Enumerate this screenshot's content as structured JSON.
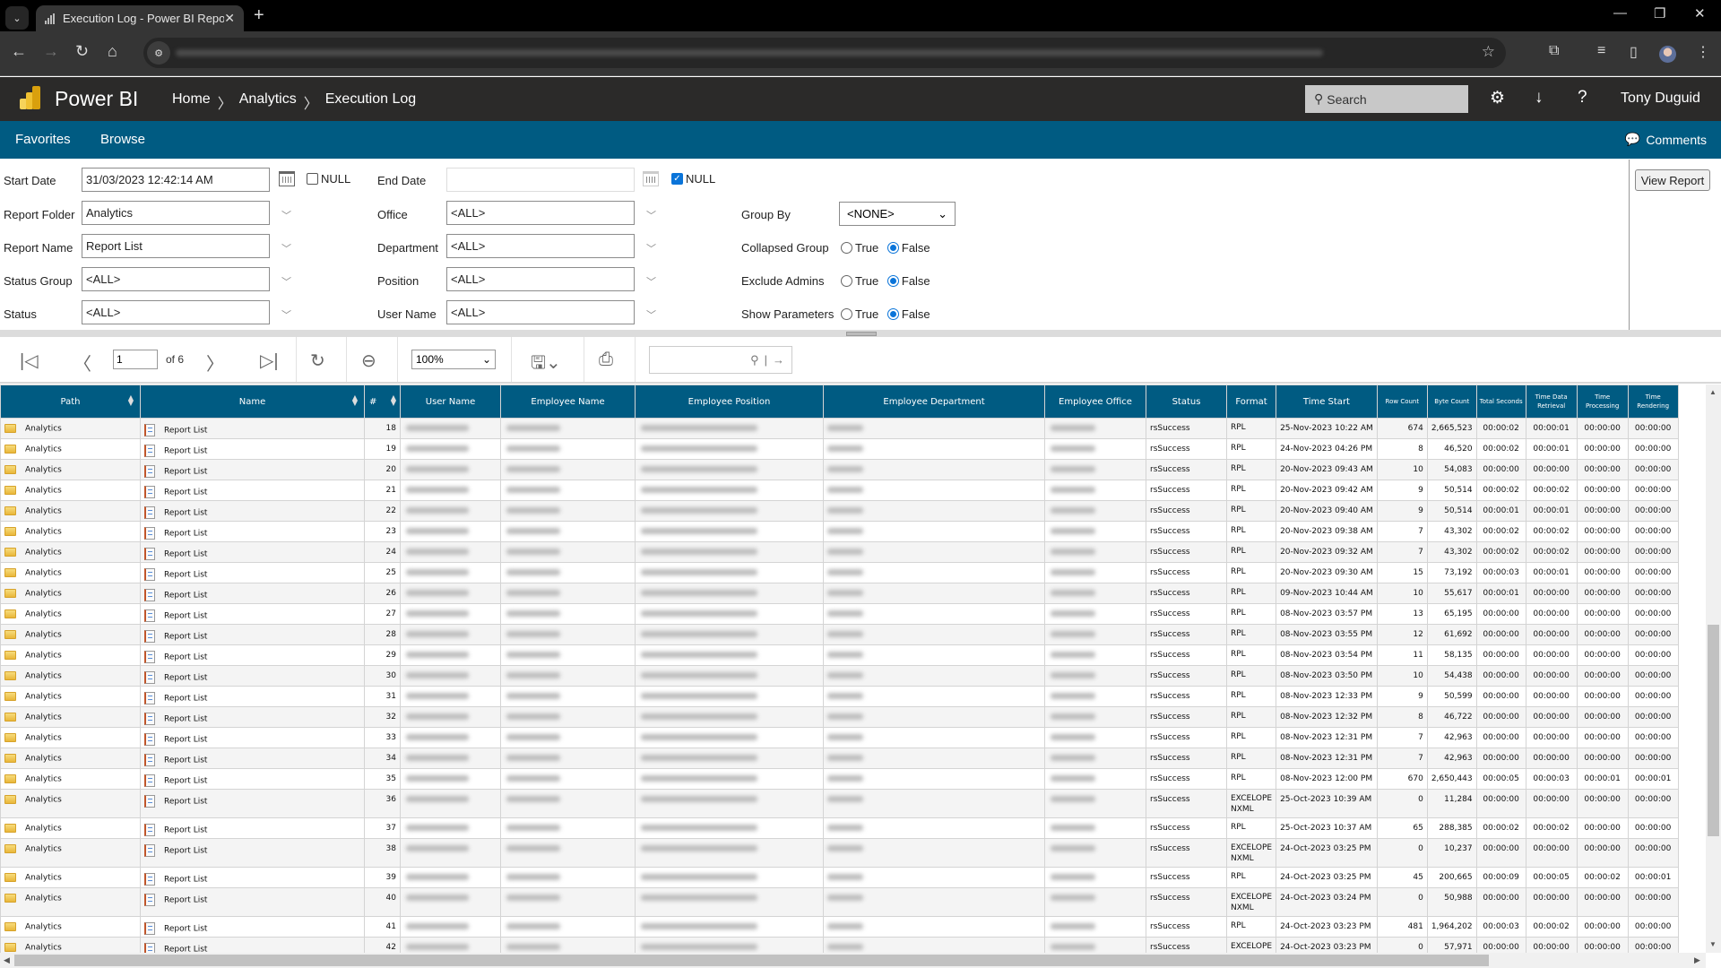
{
  "browser": {
    "tab_title": "Execution Log - Power BI Repor",
    "tab_icon": "bar-chart-icon",
    "window_controls": [
      "minimize",
      "restore",
      "close"
    ]
  },
  "header": {
    "brand": "Power BI",
    "breadcrumb": [
      "Home",
      "Analytics",
      "Execution Log"
    ],
    "search_placeholder": "Search",
    "user": "Tony Duguid"
  },
  "subnav": {
    "favorites": "Favorites",
    "browse": "Browse",
    "comments": "Comments"
  },
  "params": {
    "start_date": {
      "label": "Start Date",
      "value": "31/03/2023 12:42:14 AM",
      "null_label": "NULL",
      "null_checked": false
    },
    "end_date": {
      "label": "End Date",
      "value": "",
      "null_label": "NULL",
      "null_checked": true
    },
    "report_folder": {
      "label": "Report Folder",
      "value": "Analytics"
    },
    "report_name": {
      "label": "Report Name",
      "value": "Report List"
    },
    "status_group": {
      "label": "Status Group",
      "value": "<ALL>"
    },
    "status": {
      "label": "Status",
      "value": "<ALL>"
    },
    "office": {
      "label": "Office",
      "value": "<ALL>"
    },
    "department": {
      "label": "Department",
      "value": "<ALL>"
    },
    "position": {
      "label": "Position",
      "value": "<ALL>"
    },
    "user_name": {
      "label": "User Name",
      "value": "<ALL>"
    },
    "group_by": {
      "label": "Group By",
      "value": "<NONE>"
    },
    "collapsed_group": {
      "label": "Collapsed Group",
      "true_label": "True",
      "false_label": "False",
      "selected": "False"
    },
    "exclude_admins": {
      "label": "Exclude Admins",
      "true_label": "True",
      "false_label": "False",
      "selected": "False"
    },
    "show_parameters": {
      "label": "Show Parameters",
      "true_label": "True",
      "false_label": "False",
      "selected": "False"
    },
    "view_report": "View Report"
  },
  "toolbar": {
    "page_current": "1",
    "page_total_label": "of 6",
    "zoom": "100%"
  },
  "table": {
    "columns": [
      "Path",
      "Name",
      "#",
      "User Name",
      "Employee Name",
      "Employee Position",
      "Employee Department",
      "Employee Office",
      "Status",
      "Format",
      "Time Start",
      "Row Count",
      "Byte Count",
      "Total Seconds",
      "Time Data Retrieval",
      "Time Processing",
      "Time Rendering"
    ],
    "rows": [
      {
        "path": "Analytics",
        "name": "Report List",
        "num": "18",
        "status": "rsSuccess",
        "format": "RPL",
        "time_start": "25-Nov-2023  10:22 AM",
        "row_count": "674",
        "byte_count": "2,665,523",
        "total": "00:00:02",
        "retrieval": "00:00:01",
        "processing": "00:00:00",
        "rendering": "00:00:00"
      },
      {
        "path": "Analytics",
        "name": "Report List",
        "num": "19",
        "status": "rsSuccess",
        "format": "RPL",
        "time_start": "24-Nov-2023  04:26 PM",
        "row_count": "8",
        "byte_count": "46,520",
        "total": "00:00:02",
        "retrieval": "00:00:01",
        "processing": "00:00:00",
        "rendering": "00:00:00"
      },
      {
        "path": "Analytics",
        "name": "Report List",
        "num": "20",
        "status": "rsSuccess",
        "format": "RPL",
        "time_start": "20-Nov-2023  09:43 AM",
        "row_count": "10",
        "byte_count": "54,083",
        "total": "00:00:00",
        "retrieval": "00:00:00",
        "processing": "00:00:00",
        "rendering": "00:00:00"
      },
      {
        "path": "Analytics",
        "name": "Report List",
        "num": "21",
        "status": "rsSuccess",
        "format": "RPL",
        "time_start": "20-Nov-2023  09:42 AM",
        "row_count": "9",
        "byte_count": "50,514",
        "total": "00:00:02",
        "retrieval": "00:00:02",
        "processing": "00:00:00",
        "rendering": "00:00:00"
      },
      {
        "path": "Analytics",
        "name": "Report List",
        "num": "22",
        "status": "rsSuccess",
        "format": "RPL",
        "time_start": "20-Nov-2023  09:40 AM",
        "row_count": "9",
        "byte_count": "50,514",
        "total": "00:00:01",
        "retrieval": "00:00:01",
        "processing": "00:00:00",
        "rendering": "00:00:00"
      },
      {
        "path": "Analytics",
        "name": "Report List",
        "num": "23",
        "status": "rsSuccess",
        "format": "RPL",
        "time_start": "20-Nov-2023  09:38 AM",
        "row_count": "7",
        "byte_count": "43,302",
        "total": "00:00:02",
        "retrieval": "00:00:02",
        "processing": "00:00:00",
        "rendering": "00:00:00"
      },
      {
        "path": "Analytics",
        "name": "Report List",
        "num": "24",
        "status": "rsSuccess",
        "format": "RPL",
        "time_start": "20-Nov-2023  09:32 AM",
        "row_count": "7",
        "byte_count": "43,302",
        "total": "00:00:02",
        "retrieval": "00:00:02",
        "processing": "00:00:00",
        "rendering": "00:00:00"
      },
      {
        "path": "Analytics",
        "name": "Report List",
        "num": "25",
        "status": "rsSuccess",
        "format": "RPL",
        "time_start": "20-Nov-2023  09:30 AM",
        "row_count": "15",
        "byte_count": "73,192",
        "total": "00:00:03",
        "retrieval": "00:00:01",
        "processing": "00:00:00",
        "rendering": "00:00:00"
      },
      {
        "path": "Analytics",
        "name": "Report List",
        "num": "26",
        "status": "rsSuccess",
        "format": "RPL",
        "time_start": "09-Nov-2023  10:44 AM",
        "row_count": "10",
        "byte_count": "55,617",
        "total": "00:00:01",
        "retrieval": "00:00:00",
        "processing": "00:00:00",
        "rendering": "00:00:00"
      },
      {
        "path": "Analytics",
        "name": "Report List",
        "num": "27",
        "status": "rsSuccess",
        "format": "RPL",
        "time_start": "08-Nov-2023  03:57 PM",
        "row_count": "13",
        "byte_count": "65,195",
        "total": "00:00:00",
        "retrieval": "00:00:00",
        "processing": "00:00:00",
        "rendering": "00:00:00"
      },
      {
        "path": "Analytics",
        "name": "Report List",
        "num": "28",
        "status": "rsSuccess",
        "format": "RPL",
        "time_start": "08-Nov-2023  03:55 PM",
        "row_count": "12",
        "byte_count": "61,692",
        "total": "00:00:00",
        "retrieval": "00:00:00",
        "processing": "00:00:00",
        "rendering": "00:00:00"
      },
      {
        "path": "Analytics",
        "name": "Report List",
        "num": "29",
        "status": "rsSuccess",
        "format": "RPL",
        "time_start": "08-Nov-2023  03:54 PM",
        "row_count": "11",
        "byte_count": "58,135",
        "total": "00:00:00",
        "retrieval": "00:00:00",
        "processing": "00:00:00",
        "rendering": "00:00:00"
      },
      {
        "path": "Analytics",
        "name": "Report List",
        "num": "30",
        "status": "rsSuccess",
        "format": "RPL",
        "time_start": "08-Nov-2023  03:50 PM",
        "row_count": "10",
        "byte_count": "54,438",
        "total": "00:00:00",
        "retrieval": "00:00:00",
        "processing": "00:00:00",
        "rendering": "00:00:00"
      },
      {
        "path": "Analytics",
        "name": "Report List",
        "num": "31",
        "status": "rsSuccess",
        "format": "RPL",
        "time_start": "08-Nov-2023  12:33 PM",
        "row_count": "9",
        "byte_count": "50,599",
        "total": "00:00:00",
        "retrieval": "00:00:00",
        "processing": "00:00:00",
        "rendering": "00:00:00"
      },
      {
        "path": "Analytics",
        "name": "Report List",
        "num": "32",
        "status": "rsSuccess",
        "format": "RPL",
        "time_start": "08-Nov-2023  12:32 PM",
        "row_count": "8",
        "byte_count": "46,722",
        "total": "00:00:00",
        "retrieval": "00:00:00",
        "processing": "00:00:00",
        "rendering": "00:00:00"
      },
      {
        "path": "Analytics",
        "name": "Report List",
        "num": "33",
        "status": "rsSuccess",
        "format": "RPL",
        "time_start": "08-Nov-2023  12:31 PM",
        "row_count": "7",
        "byte_count": "42,963",
        "total": "00:00:00",
        "retrieval": "00:00:00",
        "processing": "00:00:00",
        "rendering": "00:00:00"
      },
      {
        "path": "Analytics",
        "name": "Report List",
        "num": "34",
        "status": "rsSuccess",
        "format": "RPL",
        "time_start": "08-Nov-2023  12:31 PM",
        "row_count": "7",
        "byte_count": "42,963",
        "total": "00:00:00",
        "retrieval": "00:00:00",
        "processing": "00:00:00",
        "rendering": "00:00:00"
      },
      {
        "path": "Analytics",
        "name": "Report List",
        "num": "35",
        "status": "rsSuccess",
        "format": "RPL",
        "time_start": "08-Nov-2023  12:00 PM",
        "row_count": "670",
        "byte_count": "2,650,443",
        "total": "00:00:05",
        "retrieval": "00:00:03",
        "processing": "00:00:01",
        "rendering": "00:00:01"
      },
      {
        "path": "Analytics",
        "name": "Report List",
        "num": "36",
        "status": "rsSuccess",
        "format": "EXCELOPE NXML",
        "time_start": "25-Oct-2023  10:39 AM",
        "row_count": "0",
        "byte_count": "11,284",
        "total": "00:00:00",
        "retrieval": "00:00:00",
        "processing": "00:00:00",
        "rendering": "00:00:00"
      },
      {
        "path": "Analytics",
        "name": "Report List",
        "num": "37",
        "status": "rsSuccess",
        "format": "RPL",
        "time_start": "25-Oct-2023  10:37 AM",
        "row_count": "65",
        "byte_count": "288,385",
        "total": "00:00:02",
        "retrieval": "00:00:02",
        "processing": "00:00:00",
        "rendering": "00:00:00"
      },
      {
        "path": "Analytics",
        "name": "Report List",
        "num": "38",
        "status": "rsSuccess",
        "format": "EXCELOPE NXML",
        "time_start": "24-Oct-2023  03:25 PM",
        "row_count": "0",
        "byte_count": "10,237",
        "total": "00:00:00",
        "retrieval": "00:00:00",
        "processing": "00:00:00",
        "rendering": "00:00:00"
      },
      {
        "path": "Analytics",
        "name": "Report List",
        "num": "39",
        "status": "rsSuccess",
        "format": "RPL",
        "time_start": "24-Oct-2023  03:25 PM",
        "row_count": "45",
        "byte_count": "200,665",
        "total": "00:00:09",
        "retrieval": "00:00:05",
        "processing": "00:00:02",
        "rendering": "00:00:01"
      },
      {
        "path": "Analytics",
        "name": "Report List",
        "num": "40",
        "status": "rsSuccess",
        "format": "EXCELOPE NXML",
        "time_start": "24-Oct-2023  03:24 PM",
        "row_count": "0",
        "byte_count": "50,988",
        "total": "00:00:00",
        "retrieval": "00:00:00",
        "processing": "00:00:00",
        "rendering": "00:00:00"
      },
      {
        "path": "Analytics",
        "name": "Report List",
        "num": "41",
        "status": "rsSuccess",
        "format": "RPL",
        "time_start": "24-Oct-2023  03:23 PM",
        "row_count": "481",
        "byte_count": "1,964,202",
        "total": "00:00:03",
        "retrieval": "00:00:02",
        "processing": "00:00:00",
        "rendering": "00:00:00"
      },
      {
        "path": "Analytics",
        "name": "Report List",
        "num": "42",
        "status": "rsSuccess",
        "format": "EXCELOPE NXML",
        "time_start": "24-Oct-2023  03:23 PM",
        "row_count": "0",
        "byte_count": "57,971",
        "total": "00:00:00",
        "retrieval": "00:00:00",
        "processing": "00:00:00",
        "rendering": "00:00:00"
      }
    ]
  },
  "colors": {
    "brand_blue": "#005b82",
    "header_dark": "#2b2a29",
    "accent_yellow": "#f2c811"
  }
}
